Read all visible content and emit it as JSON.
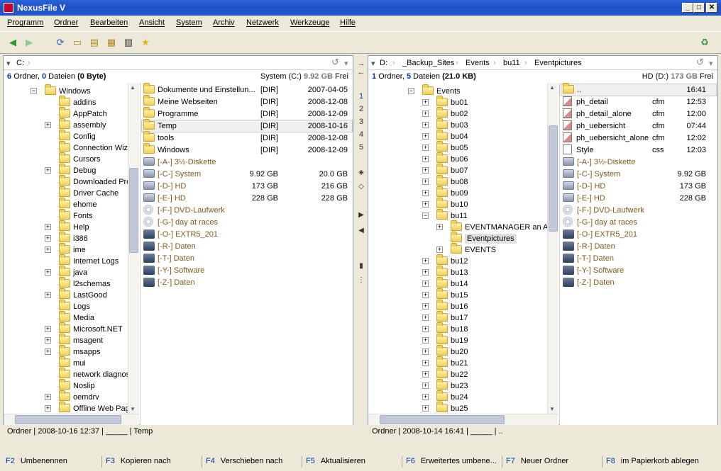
{
  "window": {
    "title": "NexusFile V",
    "btn_min": "_",
    "btn_max": "□",
    "btn_close": "✕"
  },
  "menu": [
    "Programm",
    "Ordner",
    "Bearbeiten",
    "Ansicht",
    "System",
    "Archiv",
    "Netzwerk",
    "Werkzeuge",
    "Hilfe"
  ],
  "left": {
    "path": [
      "C:"
    ],
    "info": {
      "folders": "6",
      "folders_label": "Ordner,",
      "files": "0",
      "files_label": "Dateien",
      "bytes": "(0 Byte)",
      "drive": "System (C:)",
      "free": "9.92 GB",
      "free_label": "Frei"
    },
    "tree": [
      {
        "name": "Windows",
        "exp": "−",
        "depth": 0
      },
      {
        "name": "addins",
        "exp": "",
        "depth": 1
      },
      {
        "name": "AppPatch",
        "exp": "",
        "depth": 1
      },
      {
        "name": "assembly",
        "exp": "+",
        "depth": 1
      },
      {
        "name": "Config",
        "exp": "",
        "depth": 1
      },
      {
        "name": "Connection Wizard",
        "exp": "",
        "depth": 1
      },
      {
        "name": "Cursors",
        "exp": "",
        "depth": 1
      },
      {
        "name": "Debug",
        "exp": "+",
        "depth": 1
      },
      {
        "name": "Downloaded Program Files",
        "exp": "",
        "depth": 1
      },
      {
        "name": "Driver Cache",
        "exp": "",
        "depth": 1
      },
      {
        "name": "ehome",
        "exp": "",
        "depth": 1
      },
      {
        "name": "Fonts",
        "exp": "",
        "depth": 1
      },
      {
        "name": "Help",
        "exp": "+",
        "depth": 1
      },
      {
        "name": "i386",
        "exp": "+",
        "depth": 1
      },
      {
        "name": "ime",
        "exp": "+",
        "depth": 1
      },
      {
        "name": "Internet Logs",
        "exp": "",
        "depth": 1
      },
      {
        "name": "java",
        "exp": "+",
        "depth": 1
      },
      {
        "name": "l2schemas",
        "exp": "",
        "depth": 1
      },
      {
        "name": "LastGood",
        "exp": "+",
        "depth": 1
      },
      {
        "name": "Logs",
        "exp": "",
        "depth": 1
      },
      {
        "name": "Media",
        "exp": "",
        "depth": 1
      },
      {
        "name": "Microsoft.NET",
        "exp": "+",
        "depth": 1
      },
      {
        "name": "msagent",
        "exp": "+",
        "depth": 1
      },
      {
        "name": "msapps",
        "exp": "+",
        "depth": 1
      },
      {
        "name": "mui",
        "exp": "",
        "depth": 1
      },
      {
        "name": "network diagnostic",
        "exp": "",
        "depth": 1
      },
      {
        "name": "Noslip",
        "exp": "",
        "depth": 1
      },
      {
        "name": "oemdrv",
        "exp": "+",
        "depth": 1
      },
      {
        "name": "Offline Web Pages",
        "exp": "+",
        "depth": 1
      }
    ],
    "files": [
      {
        "name": "Dokumente und Einstellun...",
        "type": "[DIR]",
        "date": "2007-04-05",
        "kind": "folder"
      },
      {
        "name": "Meine Webseiten",
        "type": "[DIR]",
        "date": "2008-12-08",
        "kind": "folder"
      },
      {
        "name": "Programme",
        "type": "[DIR]",
        "date": "2008-12-09",
        "kind": "folder"
      },
      {
        "name": "Temp",
        "type": "[DIR]",
        "date": "2008-10-16",
        "kind": "folder",
        "sel": true
      },
      {
        "name": "tools",
        "type": "[DIR]",
        "date": "2008-12-08",
        "kind": "folder"
      },
      {
        "name": "Windows",
        "type": "[DIR]",
        "date": "2008-12-09",
        "kind": "folder"
      },
      {
        "name": "[-A-] 3½-Diskette",
        "type": "",
        "date": "",
        "kind": "drive"
      },
      {
        "name": "[-C-] System",
        "type": "9.92 GB",
        "date": "20.0 GB",
        "kind": "drive"
      },
      {
        "name": "[-D-] HD",
        "type": "173 GB",
        "date": "216 GB",
        "kind": "drive"
      },
      {
        "name": "[-E-] HD",
        "type": "228 GB",
        "date": "228 GB",
        "kind": "drive"
      },
      {
        "name": "[-F-] DVD-Laufwerk",
        "type": "",
        "date": "",
        "kind": "cd"
      },
      {
        "name": "[-G-] day at races",
        "type": "",
        "date": "",
        "kind": "cd"
      },
      {
        "name": "[-O-] EXTR5_201",
        "type": "",
        "date": "",
        "kind": "net"
      },
      {
        "name": "[-R-] Daten",
        "type": "",
        "date": "",
        "kind": "net"
      },
      {
        "name": "[-T-] Daten",
        "type": "",
        "date": "",
        "kind": "net"
      },
      {
        "name": "[-Y-] Software",
        "type": "",
        "date": "",
        "kind": "net"
      },
      {
        "name": "[-Z-] Daten",
        "type": "",
        "date": "",
        "kind": "net"
      }
    ],
    "status": "Ordner | 2008-10-16 12:37 | _____ | Temp"
  },
  "right": {
    "path": [
      "D:",
      "_Backup_Sites",
      "Events",
      "bu11",
      "Eventpictures"
    ],
    "info": {
      "folders": "1",
      "folders_label": "Ordner,",
      "files": "5",
      "files_label": "Dateien",
      "bytes": "(21.0 KB)",
      "drive": "HD (D:)",
      "free": "173 GB",
      "free_label": "Frei"
    },
    "tree": [
      {
        "name": "Events",
        "exp": "−",
        "depth": 0
      },
      {
        "name": "bu01",
        "exp": "+",
        "depth": 1
      },
      {
        "name": "bu02",
        "exp": "+",
        "depth": 1
      },
      {
        "name": "bu03",
        "exp": "+",
        "depth": 1
      },
      {
        "name": "bu04",
        "exp": "+",
        "depth": 1
      },
      {
        "name": "bu05",
        "exp": "+",
        "depth": 1
      },
      {
        "name": "bu06",
        "exp": "+",
        "depth": 1
      },
      {
        "name": "bu07",
        "exp": "+",
        "depth": 1
      },
      {
        "name": "bu08",
        "exp": "+",
        "depth": 1
      },
      {
        "name": "bu09",
        "exp": "+",
        "depth": 1
      },
      {
        "name": "bu10",
        "exp": "+",
        "depth": 1
      },
      {
        "name": "bu11",
        "exp": "−",
        "depth": 1
      },
      {
        "name": "EVENTMANAGER an A-fs",
        "exp": "+",
        "depth": 2
      },
      {
        "name": "Eventpictures",
        "exp": "",
        "depth": 2,
        "sel": true
      },
      {
        "name": "EVENTS",
        "exp": "+",
        "depth": 2
      },
      {
        "name": "bu12",
        "exp": "+",
        "depth": 1
      },
      {
        "name": "bu13",
        "exp": "+",
        "depth": 1
      },
      {
        "name": "bu14",
        "exp": "+",
        "depth": 1
      },
      {
        "name": "bu15",
        "exp": "+",
        "depth": 1
      },
      {
        "name": "bu16",
        "exp": "+",
        "depth": 1
      },
      {
        "name": "bu17",
        "exp": "+",
        "depth": 1
      },
      {
        "name": "bu18",
        "exp": "+",
        "depth": 1
      },
      {
        "name": "bu19",
        "exp": "+",
        "depth": 1
      },
      {
        "name": "bu20",
        "exp": "+",
        "depth": 1
      },
      {
        "name": "bu21",
        "exp": "+",
        "depth": 1
      },
      {
        "name": "bu22",
        "exp": "+",
        "depth": 1
      },
      {
        "name": "bu23",
        "exp": "+",
        "depth": 1
      },
      {
        "name": "bu24",
        "exp": "+",
        "depth": 1
      },
      {
        "name": "bu25",
        "exp": "+",
        "depth": 1
      }
    ],
    "files": [
      {
        "name": "..",
        "type": "",
        "date": "16:41",
        "kind": "folder",
        "sel": true
      },
      {
        "name": "ph_detail",
        "type": "cfm",
        "date": "12:53",
        "kind": "cfm"
      },
      {
        "name": "ph_detail_alone",
        "type": "cfm",
        "date": "12:00",
        "kind": "cfm"
      },
      {
        "name": "ph_uebersicht",
        "type": "cfm",
        "date": "07:44",
        "kind": "cfm"
      },
      {
        "name": "ph_uebersicht_alone",
        "type": "cfm",
        "date": "12:02",
        "kind": "cfm"
      },
      {
        "name": "Style",
        "type": "css",
        "date": "12:03",
        "kind": "file"
      },
      {
        "name": "[-A-] 3½-Diskette",
        "type": "",
        "date": "",
        "kind": "drive"
      },
      {
        "name": "[-C-] System",
        "type": "",
        "date": "9.92 GB",
        "kind": "drive"
      },
      {
        "name": "[-D-] HD",
        "type": "",
        "date": "173 GB",
        "kind": "drive"
      },
      {
        "name": "[-E-] HD",
        "type": "",
        "date": "228 GB",
        "kind": "drive"
      },
      {
        "name": "[-F-] DVD-Laufwerk",
        "type": "",
        "date": "",
        "kind": "cd"
      },
      {
        "name": "[-G-] day at races",
        "type": "",
        "date": "",
        "kind": "cd"
      },
      {
        "name": "[-O-] EXTR5_201",
        "type": "",
        "date": "",
        "kind": "net"
      },
      {
        "name": "[-R-] Daten",
        "type": "",
        "date": "",
        "kind": "net"
      },
      {
        "name": "[-T-] Daten",
        "type": "",
        "date": "",
        "kind": "net"
      },
      {
        "name": "[-Y-] Software",
        "type": "",
        "date": "",
        "kind": "net"
      },
      {
        "name": "[-Z-] Daten",
        "type": "",
        "date": "",
        "kind": "net"
      }
    ],
    "status": "Ordner | 2008-10-14 16:41 | _____ | .."
  },
  "middle": {
    "tabs": [
      "1",
      "2",
      "3",
      "4",
      "5"
    ]
  },
  "fkeys": [
    {
      "key": "F2",
      "label": "Umbenennen"
    },
    {
      "key": "F3",
      "label": "Kopieren nach"
    },
    {
      "key": "F4",
      "label": "Verschieben nach"
    },
    {
      "key": "F5",
      "label": "Aktualisieren"
    },
    {
      "key": "F6",
      "label": "Erweitertes umbene..."
    },
    {
      "key": "F7",
      "label": "Neuer Ordner"
    },
    {
      "key": "F8",
      "label": "im Papierkorb ablegen"
    }
  ]
}
